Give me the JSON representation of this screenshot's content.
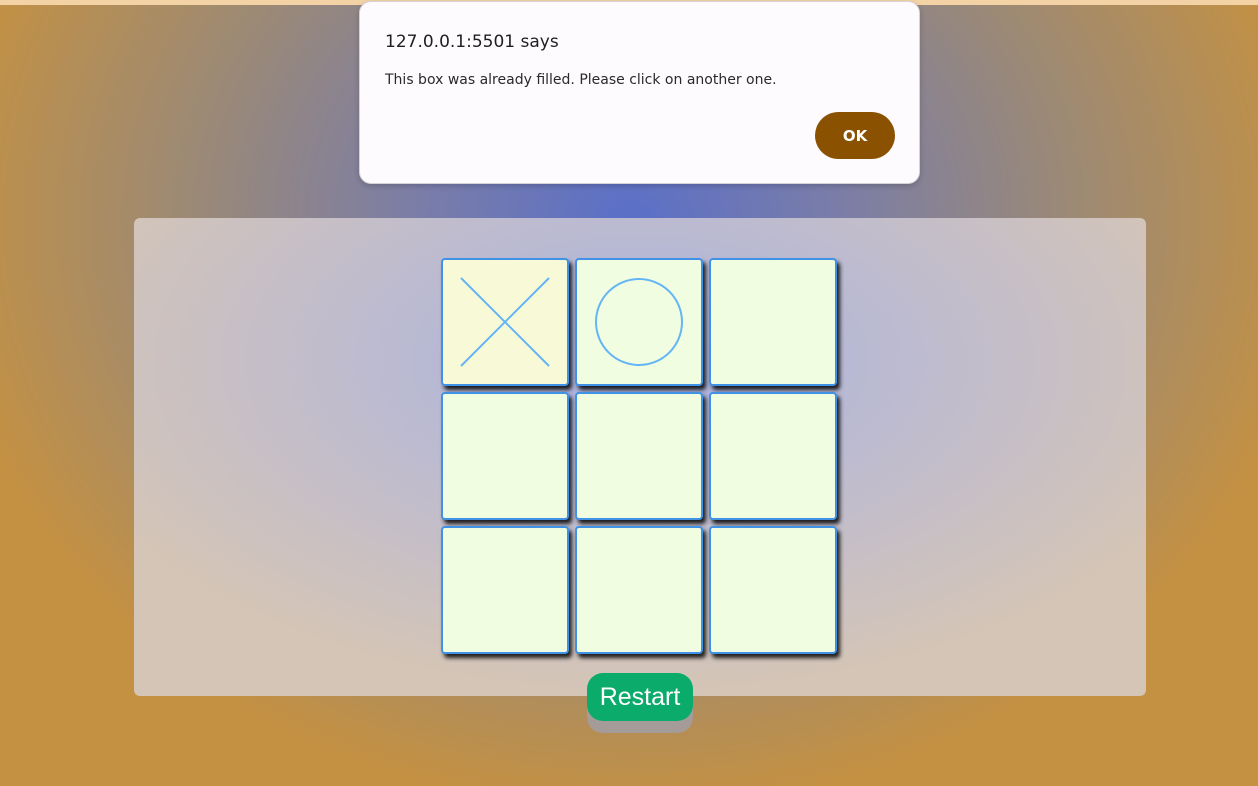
{
  "dialog": {
    "title": "127.0.0.1:5501 says",
    "message": "This box was already filled. Please click on another one.",
    "ok_label": "OK"
  },
  "board": {
    "cells": [
      "X",
      "O",
      "",
      "",
      "",
      "",
      "",
      "",
      ""
    ]
  },
  "restart": {
    "label": "Restart"
  },
  "colors": {
    "mark": "#64b5f6",
    "cell_border": "#3f92e6",
    "cell_bg": "#f0fde0",
    "cell_x_bg": "#f8f9d7",
    "restart_bg": "#0aab6b",
    "ok_bg": "#8a5200"
  }
}
